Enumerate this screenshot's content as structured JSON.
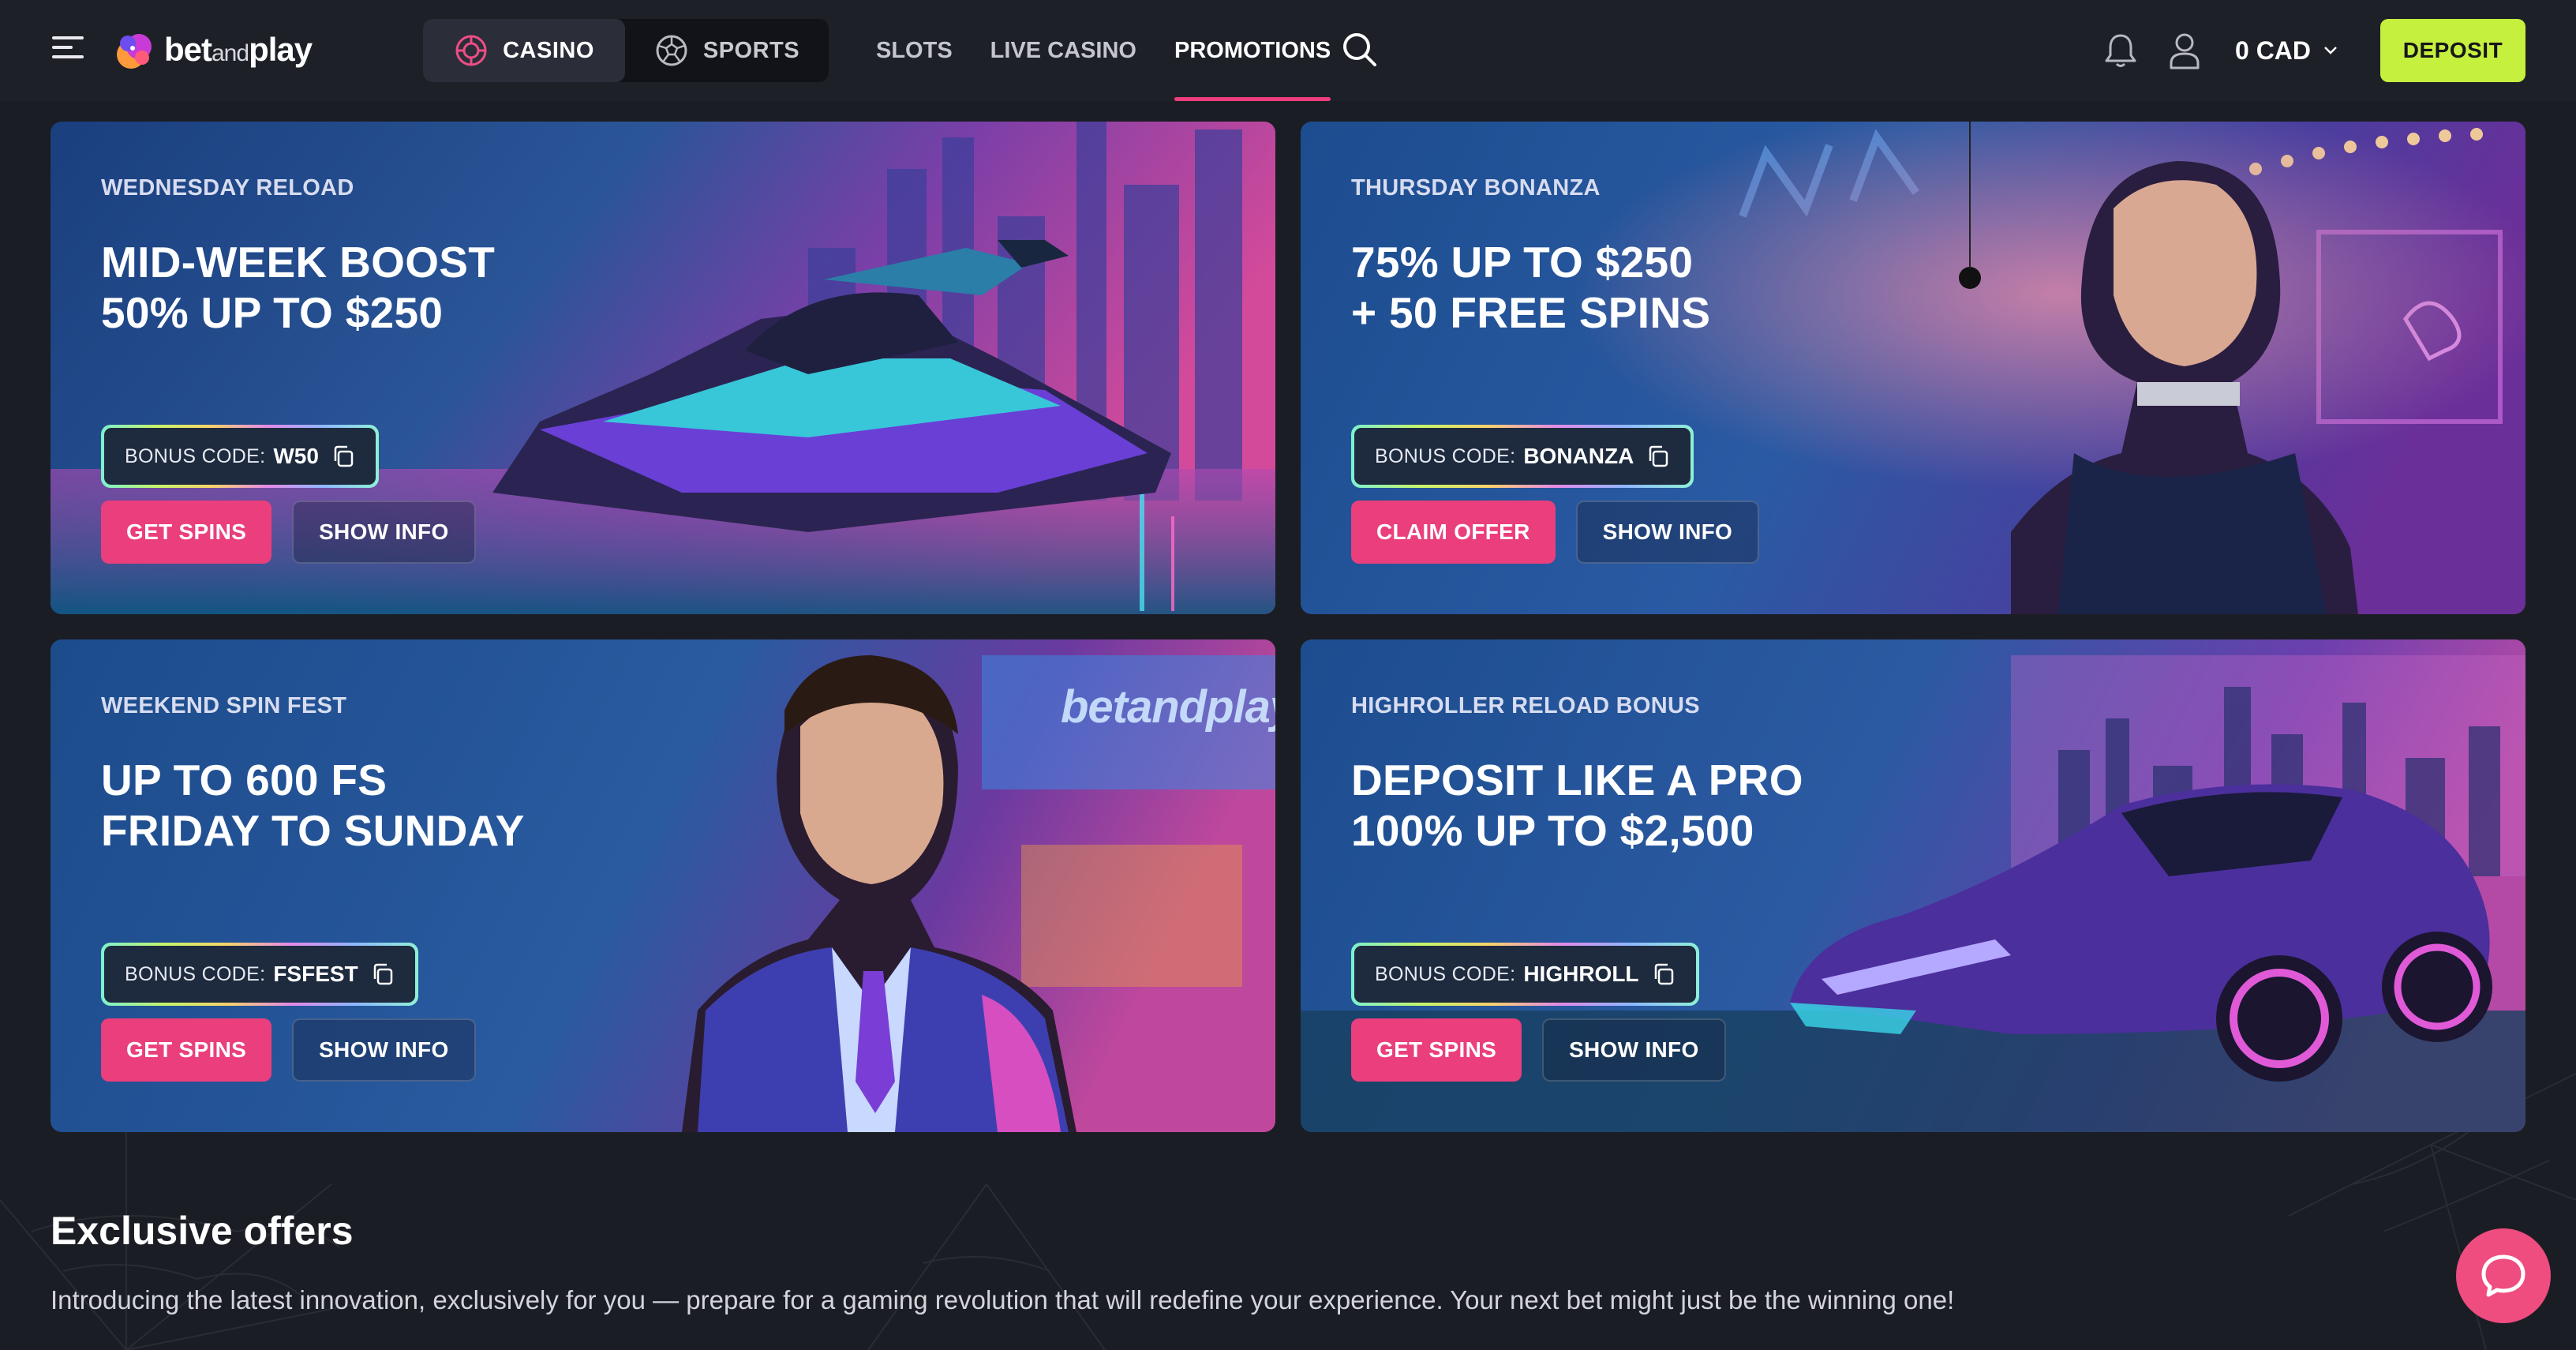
{
  "header": {
    "logo": {
      "part1": "bet",
      "part2": "and",
      "part3": "play"
    },
    "segments": [
      {
        "label": "CASINO",
        "icon": "casino-chip-icon",
        "active": true
      },
      {
        "label": "SPORTS",
        "icon": "soccer-ball-icon",
        "active": false
      }
    ],
    "nav": [
      {
        "label": "SLOTS",
        "active": false
      },
      {
        "label": "LIVE CASINO",
        "active": false
      },
      {
        "label": "PROMOTIONS",
        "active": true
      }
    ],
    "balance": "0 CAD",
    "deposit_label": "DEPOSIT"
  },
  "promos": [
    {
      "kicker": "WEDNESDAY RELOAD",
      "title_line1": "MID-WEEK BOOST",
      "title_line2": "50% UP TO $250",
      "code_label": "BONUS CODE:",
      "code": "W50",
      "primary": "GET SPINS",
      "secondary": "SHOW INFO",
      "art": "jet-ski"
    },
    {
      "kicker": "THURSDAY BONANZA",
      "title_line1": "75% UP TO $250",
      "title_line2": "+ 50 FREE SPINS",
      "code_label": "BONUS CODE:",
      "code": "BONANZA",
      "primary": "CLAIM OFFER",
      "secondary": "SHOW INFO",
      "art": "woman-casino"
    },
    {
      "kicker": "WEEKEND SPIN FEST",
      "title_line1": "UP TO 600 FS",
      "title_line2": "FRIDAY TO SUNDAY",
      "code_label": "BONUS CODE:",
      "code": "FSFEST",
      "primary": "GET SPINS",
      "secondary": "SHOW INFO",
      "art": "man-suit",
      "sign": "betandplay"
    },
    {
      "kicker": "HIGHROLLER RELOAD BONUS",
      "title_line1": "DEPOSIT LIKE A PRO",
      "title_line2": "100% UP TO $2,500",
      "code_label": "BONUS CODE:",
      "code": "HIGHROLL",
      "primary": "GET SPINS",
      "secondary": "SHOW INFO",
      "art": "sports-car"
    }
  ],
  "exclusive": {
    "title": "Exclusive offers",
    "text": "Introducing the latest innovation, exclusively for you — prepare for a gaming revolution that will redefine your experience. Your next bet might just be the winning one!"
  },
  "colors": {
    "accent_pink": "#ea3f7c",
    "deposit_green": "#c6f03e",
    "background": "#1b1d24"
  }
}
